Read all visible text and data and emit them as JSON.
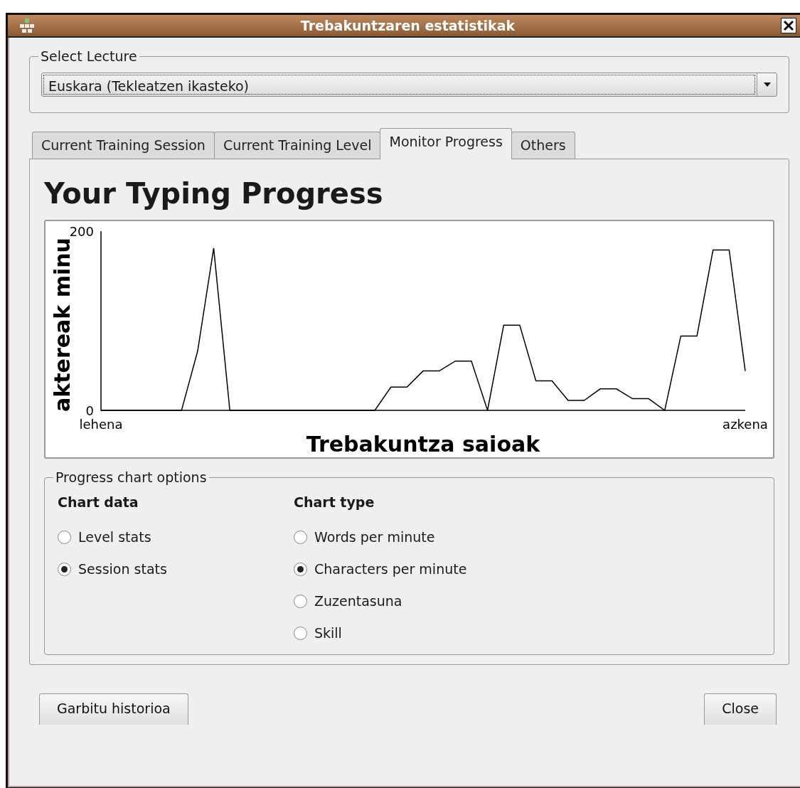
{
  "window": {
    "title": "Trebakuntzaren estatistikak"
  },
  "lecture": {
    "legend": "Select Lecture",
    "value": "Euskara (Tekleatzen ikasteko)"
  },
  "tabs": [
    {
      "label": "Current Training Session",
      "selected": false
    },
    {
      "label": "Current Training Level",
      "selected": false
    },
    {
      "label": "Monitor Progress",
      "selected": true
    },
    {
      "label": "Others",
      "selected": false
    }
  ],
  "progress": {
    "title": "Your Typing Progress",
    "chart_data": {
      "type": "line",
      "xlabel": "Trebakuntza saioak",
      "ylabel": "aktereak minu",
      "categories": [
        "lehena",
        null,
        null,
        null,
        null,
        null,
        null,
        null,
        null,
        null,
        null,
        null,
        null,
        null,
        null,
        null,
        null,
        null,
        null,
        null,
        null,
        null,
        null,
        null,
        null,
        null,
        null,
        null,
        null,
        null,
        null,
        null,
        null,
        null,
        null,
        null,
        null,
        null,
        null,
        null,
        "azkena"
      ],
      "values": [
        0,
        0,
        0,
        0,
        0,
        0,
        66,
        181,
        0,
        0,
        0,
        0,
        0,
        0,
        0,
        0,
        0,
        0,
        26,
        26,
        44,
        44,
        55,
        55,
        0,
        95,
        95,
        33,
        33,
        11,
        11,
        24,
        24,
        13,
        13,
        0,
        83,
        83,
        179,
        179,
        44
      ],
      "ylim": [
        0,
        200
      ],
      "yticks": [
        0,
        200
      ]
    }
  },
  "options": {
    "legend": "Progress chart options",
    "groups": [
      {
        "heading": "Chart data",
        "items": [
          {
            "label": "Level stats",
            "selected": false
          },
          {
            "label": "Session stats",
            "selected": true
          }
        ]
      },
      {
        "heading": "Chart type",
        "items": [
          {
            "label": "Words per minute",
            "selected": false
          },
          {
            "label": "Characters per minute",
            "selected": true
          },
          {
            "label": "Zuzentasuna",
            "selected": false
          },
          {
            "label": "Skill",
            "selected": false
          }
        ]
      }
    ]
  },
  "buttons": [
    {
      "label": "Garbitu historioa"
    },
    {
      "label": "Close"
    }
  ]
}
